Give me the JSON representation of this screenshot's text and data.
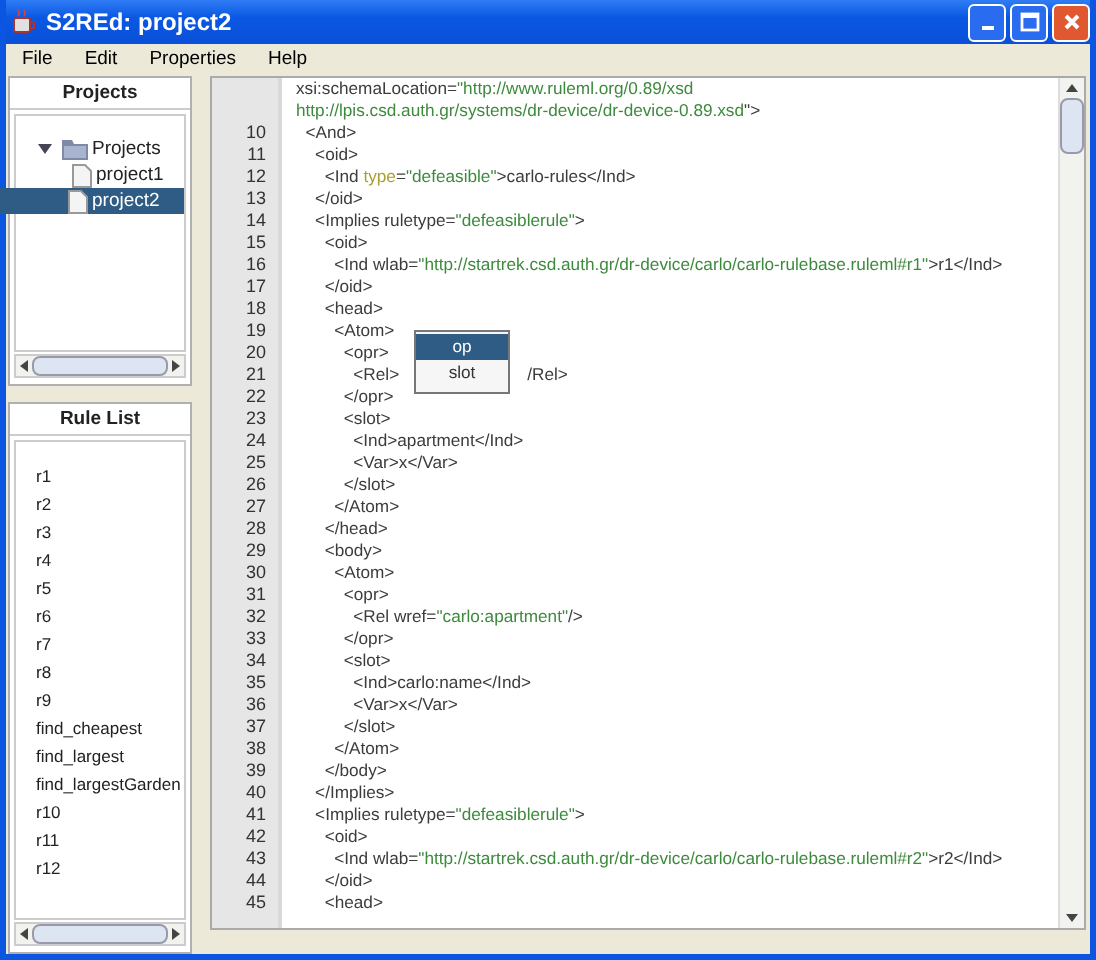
{
  "window": {
    "title": "S2REd: project2"
  },
  "menu": [
    "File",
    "Edit",
    "Properties",
    "Help"
  ],
  "projects": {
    "title": "Projects",
    "tree": [
      {
        "label": "Projects",
        "kind": "folder",
        "expanded": true,
        "selected": false,
        "children": [
          {
            "label": "project1",
            "kind": "file",
            "selected": false
          },
          {
            "label": "project2",
            "kind": "file",
            "selected": true
          }
        ]
      }
    ]
  },
  "rule_list": {
    "title": "Rule List",
    "items": [
      "r1",
      "r2",
      "r3",
      "r4",
      "r5",
      "r6",
      "r7",
      "r8",
      "r9",
      "find_cheapest",
      "find_largest",
      "find_largestGarden",
      "r10",
      "r11",
      "r12"
    ]
  },
  "editor": {
    "lines": [
      {
        "segments": [
          {
            "text": "xsi:schemaLocation=",
            "kind": "tag"
          },
          {
            "text": "\"http://www.ruleml.org/0.89/xsd",
            "kind": "string"
          }
        ]
      },
      {
        "segments": [
          {
            "text": "http://lpis.csd.auth.gr/systems/dr-device/dr-device-0.89.xsd",
            "kind": "string"
          },
          {
            "text": "\">",
            "kind": "tag"
          }
        ]
      },
      {
        "number": "10",
        "segments": [
          {
            "text": "  <And>",
            "kind": "tag"
          }
        ]
      },
      {
        "number": "11",
        "segments": [
          {
            "text": "    <oid>",
            "kind": "tag"
          }
        ]
      },
      {
        "number": "12",
        "segments": [
          {
            "text": "      <Ind ",
            "kind": "tag"
          },
          {
            "text": "type",
            "kind": "attr"
          },
          {
            "text": "=",
            "kind": "tag"
          },
          {
            "text": "\"defeasible\"",
            "kind": "string"
          },
          {
            "text": ">carlo-rules</Ind>",
            "kind": "tag"
          }
        ]
      },
      {
        "number": "13",
        "segments": [
          {
            "text": "    </oid>",
            "kind": "tag"
          }
        ]
      },
      {
        "number": "14",
        "segments": [
          {
            "text": "    <Implies ruletype=",
            "kind": "tag"
          },
          {
            "text": "\"defeasiblerule\"",
            "kind": "string"
          },
          {
            "text": ">",
            "kind": "tag"
          }
        ]
      },
      {
        "number": "15",
        "segments": [
          {
            "text": "      <oid>",
            "kind": "tag"
          }
        ]
      },
      {
        "number": "16",
        "segments": [
          {
            "text": "        <Ind wlab=",
            "kind": "tag"
          },
          {
            "text": "\"http://startrek.csd.auth.gr/dr-device/carlo/carlo-rulebase.ruleml#r1\"",
            "kind": "string"
          },
          {
            "text": ">r1</Ind>",
            "kind": "tag"
          }
        ]
      },
      {
        "number": "17",
        "segments": [
          {
            "text": "      </oid>",
            "kind": "tag"
          }
        ]
      },
      {
        "number": "18",
        "segments": [
          {
            "text": "      <head>",
            "kind": "tag"
          }
        ]
      },
      {
        "number": "19",
        "segments": [
          {
            "text": "        <Atom>",
            "kind": "tag"
          }
        ]
      },
      {
        "number": "20",
        "segments": [
          {
            "text": "          <opr>",
            "kind": "tag"
          }
        ]
      },
      {
        "number": "21",
        "segments": [
          {
            "text": "            <Rel>",
            "kind": "tag"
          },
          {
            "text": "/Rel>",
            "kind": "tag-after-popup"
          }
        ]
      },
      {
        "number": "22",
        "segments": [
          {
            "text": "          </opr>",
            "kind": "tag"
          }
        ]
      },
      {
        "number": "23",
        "segments": [
          {
            "text": "          <slot>",
            "kind": "tag"
          }
        ]
      },
      {
        "number": "24",
        "segments": [
          {
            "text": "            <Ind>apartment</Ind>",
            "kind": "tag"
          }
        ]
      },
      {
        "number": "25",
        "segments": [
          {
            "text": "            <Var>x</Var>",
            "kind": "tag"
          }
        ]
      },
      {
        "number": "26",
        "segments": [
          {
            "text": "          </slot>",
            "kind": "tag"
          }
        ]
      },
      {
        "number": "27",
        "segments": [
          {
            "text": "        </Atom>",
            "kind": "tag"
          }
        ]
      },
      {
        "number": "28",
        "segments": [
          {
            "text": "      </head>",
            "kind": "tag"
          }
        ]
      },
      {
        "number": "29",
        "segments": [
          {
            "text": "      <body>",
            "kind": "tag"
          }
        ]
      },
      {
        "number": "30",
        "segments": [
          {
            "text": "        <Atom>",
            "kind": "tag"
          }
        ]
      },
      {
        "number": "31",
        "segments": [
          {
            "text": "          <opr>",
            "kind": "tag"
          }
        ]
      },
      {
        "number": "32",
        "segments": [
          {
            "text": "            <Rel wref=",
            "kind": "tag"
          },
          {
            "text": "\"carlo:apartment\"",
            "kind": "string"
          },
          {
            "text": "/>",
            "kind": "tag"
          }
        ]
      },
      {
        "number": "33",
        "segments": [
          {
            "text": "          </opr>",
            "kind": "tag"
          }
        ]
      },
      {
        "number": "34",
        "segments": [
          {
            "text": "          <slot>",
            "kind": "tag"
          }
        ]
      },
      {
        "number": "35",
        "segments": [
          {
            "text": "            <Ind>carlo:name</Ind>",
            "kind": "tag"
          }
        ]
      },
      {
        "number": "36",
        "segments": [
          {
            "text": "            <Var>x</Var>",
            "kind": "tag"
          }
        ]
      },
      {
        "number": "37",
        "segments": [
          {
            "text": "          </slot>",
            "kind": "tag"
          }
        ]
      },
      {
        "number": "38",
        "segments": [
          {
            "text": "        </Atom>",
            "kind": "tag"
          }
        ]
      },
      {
        "number": "39",
        "segments": [
          {
            "text": "      </body>",
            "kind": "tag"
          }
        ]
      },
      {
        "number": "40",
        "segments": [
          {
            "text": "    </Implies>",
            "kind": "tag"
          }
        ]
      },
      {
        "number": "41",
        "segments": [
          {
            "text": "    <Implies ruletype=",
            "kind": "tag"
          },
          {
            "text": "\"defeasiblerule\"",
            "kind": "string"
          },
          {
            "text": ">",
            "kind": "tag"
          }
        ]
      },
      {
        "number": "42",
        "segments": [
          {
            "text": "      <oid>",
            "kind": "tag"
          }
        ]
      },
      {
        "number": "43",
        "segments": [
          {
            "text": "        <Ind wlab=",
            "kind": "tag"
          },
          {
            "text": "\"http://startrek.csd.auth.gr/dr-device/carlo/carlo-rulebase.ruleml#r2\"",
            "kind": "string"
          },
          {
            "text": ">r2</Ind>",
            "kind": "tag"
          }
        ]
      },
      {
        "number": "44",
        "segments": [
          {
            "text": "      </oid>",
            "kind": "tag"
          }
        ]
      },
      {
        "number": "45",
        "segments": [
          {
            "text": "      <head>",
            "kind": "tag"
          }
        ]
      }
    ]
  },
  "popup": {
    "items": [
      {
        "label": "op",
        "selected": true
      },
      {
        "label": "slot",
        "selected": false
      }
    ]
  }
}
